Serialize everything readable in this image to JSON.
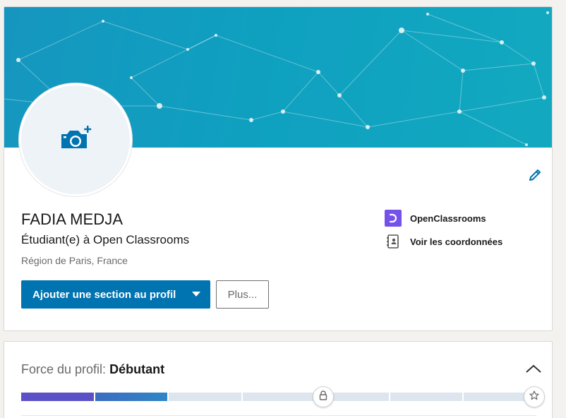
{
  "profile": {
    "name": "FADIA MEDJA",
    "headline": "Étudiant(e) à Open Classrooms",
    "location": "Région de Paris, France",
    "avatar_icon": "camera-add-icon",
    "edit_icon": "pencil-icon",
    "primary_action": "Ajouter une section au profil",
    "more_action": "Plus...",
    "education": "OpenClassrooms",
    "contact_info": "Voir les coordonnées",
    "colors": {
      "primary": "#0073b1",
      "openclassrooms": "#7451eb"
    }
  },
  "strength": {
    "label": "Force du profil:",
    "level": "Débutant",
    "segments_total": 7,
    "segments_filled": 2,
    "icons": [
      "lock-icon",
      "star-icon",
      "chevron-up-icon"
    ]
  }
}
